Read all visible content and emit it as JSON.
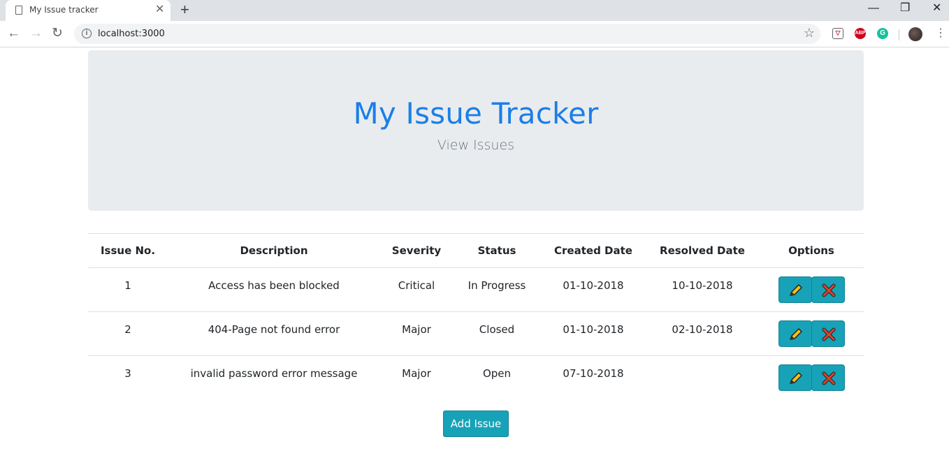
{
  "browser": {
    "tab_title": "My Issue tracker",
    "url": "localhost:3000"
  },
  "header": {
    "title": "My Issue Tracker",
    "subtitle": "View Issues"
  },
  "table": {
    "columns": [
      "Issue No.",
      "Description",
      "Severity",
      "Status",
      "Created Date",
      "Resolved Date",
      "Options"
    ],
    "rows": [
      {
        "no": "1",
        "description": "Access has been blocked",
        "severity": "Critical",
        "status": "In Progress",
        "created": "01-10-2018",
        "resolved": "10-10-2018"
      },
      {
        "no": "2",
        "description": "404-Page not found error",
        "severity": "Major",
        "status": "Closed",
        "created": "01-10-2018",
        "resolved": "02-10-2018"
      },
      {
        "no": "3",
        "description": "invalid password error message",
        "severity": "Major",
        "status": "Open",
        "created": "07-10-2018",
        "resolved": ""
      }
    ]
  },
  "actions": {
    "add_label": "Add Issue",
    "edit_icon": "pencil-icon",
    "delete_icon": "cross-icon"
  },
  "colors": {
    "accent": "#17a2b8",
    "title": "#1a7fe8",
    "jumbotron": "#e9ecef"
  }
}
